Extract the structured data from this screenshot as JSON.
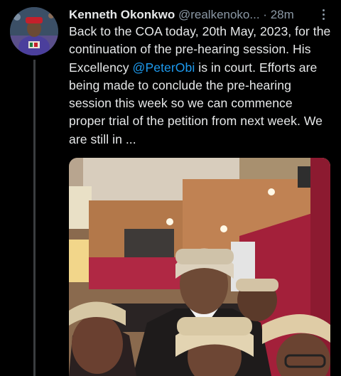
{
  "tweet": {
    "author_name": "Kenneth Okonkwo",
    "handle": "@realkenoko...",
    "separator": "·",
    "time": "28m",
    "text_before_mention": "Back to the COA today, 20th May, 2023, for the continuation of the pre-hearing session. His Excellency ",
    "mention": "@PeterObi",
    "text_after_mention": " is in court. Efforts are being made to conclude the pre-hearing session this week so we can commence proper trial of the petition from next week. We are still in ...",
    "mention_color": "#1d9bf0"
  },
  "icons": {
    "more": "more-vertical-icon"
  }
}
